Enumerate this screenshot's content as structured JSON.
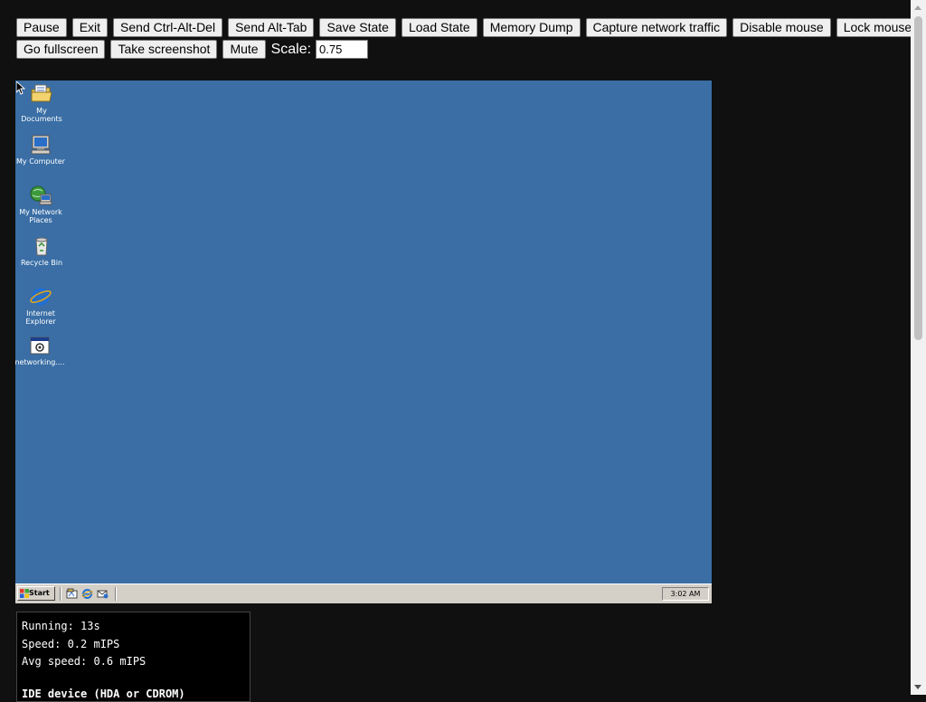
{
  "toolbar": {
    "row1": {
      "pause": "Pause",
      "exit": "Exit",
      "send_cad": "Send Ctrl-Alt-Del",
      "send_alt_tab": "Send Alt-Tab",
      "save_state": "Save State",
      "load_state": "Load State",
      "memory_dump": "Memory Dump",
      "capture_network": "Capture network traffic",
      "disable_mouse": "Disable mouse",
      "lock_mouse": "Lock mouse"
    },
    "row2": {
      "fullscreen": "Go fullscreen",
      "screenshot": "Take screenshot",
      "mute": "Mute",
      "scale_label": "Scale:",
      "scale_value": "0.75"
    }
  },
  "desktop": {
    "background_color": "#3a6ea5",
    "icons": [
      {
        "label": "My Documents",
        "icon": "folder-documents-icon"
      },
      {
        "label": "My Computer",
        "icon": "computer-icon"
      },
      {
        "label": "My Network Places",
        "icon": "network-places-icon"
      },
      {
        "label": "Recycle Bin",
        "icon": "recycle-bin-icon"
      },
      {
        "label": "Internet Explorer",
        "icon": "internet-explorer-icon"
      },
      {
        "label": "networking....",
        "icon": "script-file-icon"
      }
    ]
  },
  "taskbar": {
    "start_label": "Start",
    "clock": "3:02 AM",
    "quick_launch": [
      "show-desktop-icon",
      "internet-explorer-icon",
      "outlook-express-icon"
    ]
  },
  "status_panel": {
    "running": "Running: 13s",
    "speed": "Speed: 0.2 mIPS",
    "avg_speed": "Avg speed: 0.6 mIPS",
    "ide_device": "IDE device (HDA or CDROM)"
  }
}
